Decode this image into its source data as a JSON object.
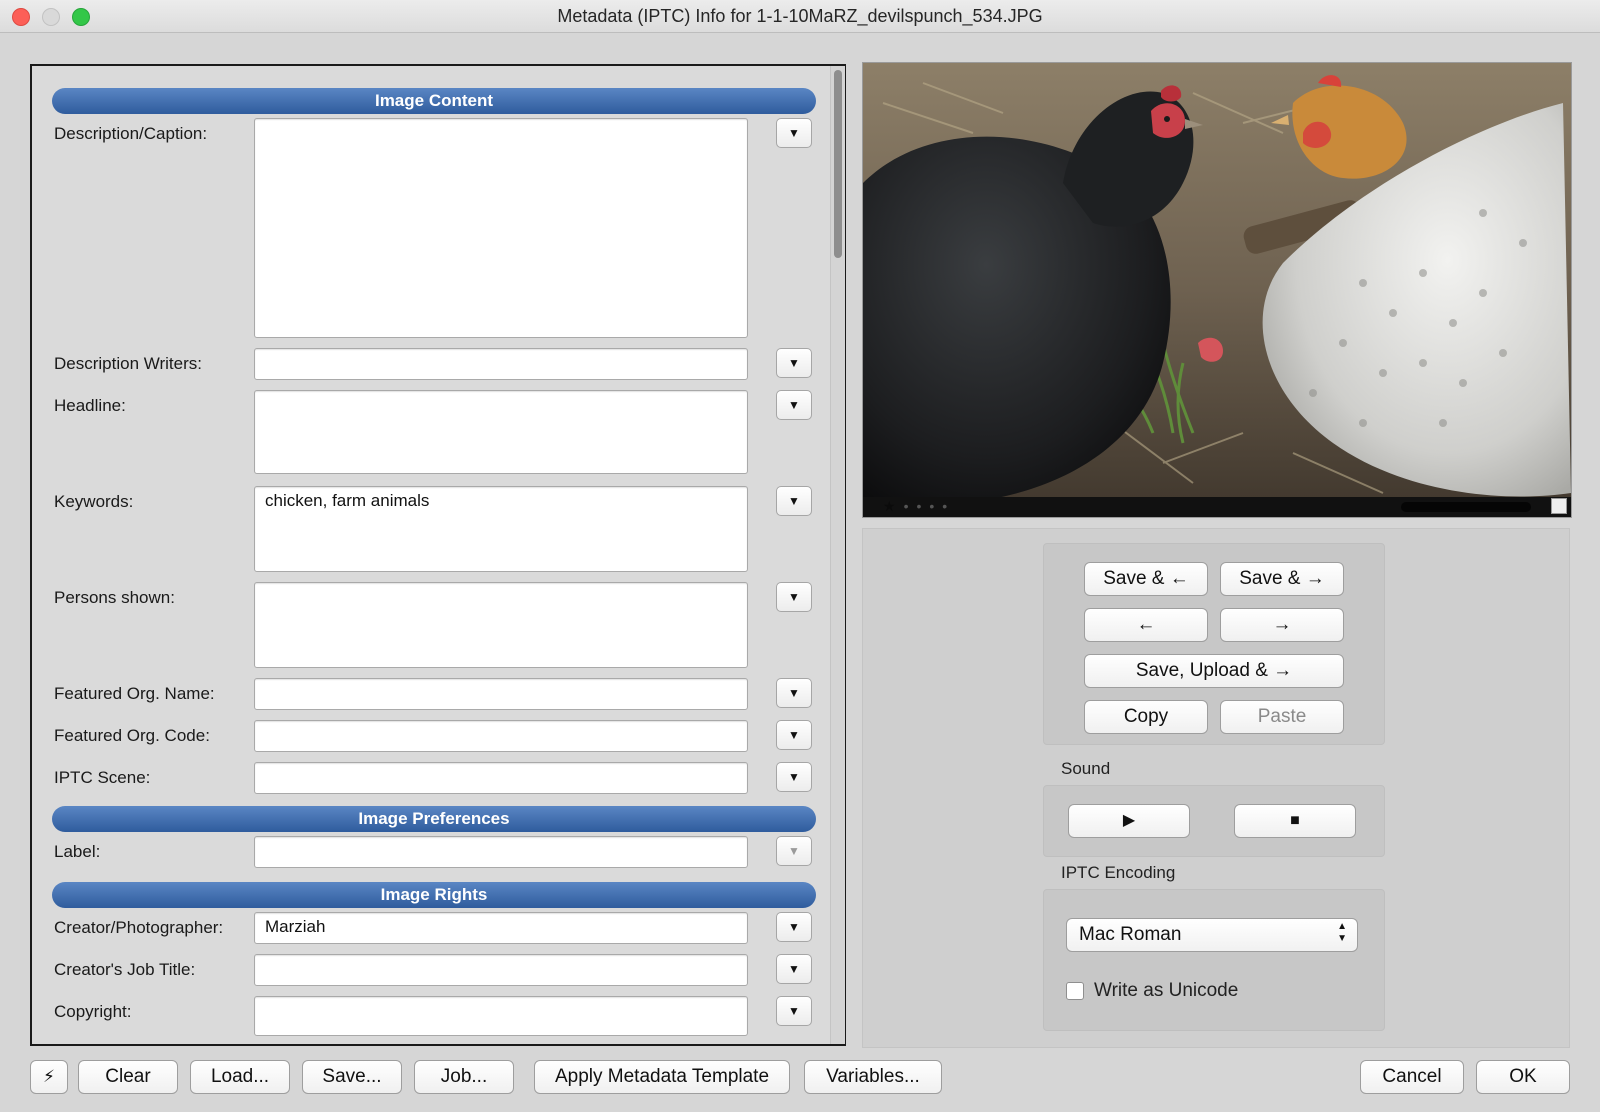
{
  "window": {
    "title": "Metadata (IPTC) Info for 1-1-10MaRZ_devilspunch_534.JPG"
  },
  "sections": {
    "content": "Image Content",
    "preferences": "Image Preferences",
    "rights": "Image Rights"
  },
  "fields": {
    "description_caption": {
      "label": "Description/Caption:",
      "value": ""
    },
    "description_writers": {
      "label": "Description Writers:",
      "value": ""
    },
    "headline": {
      "label": "Headline:",
      "value": ""
    },
    "keywords": {
      "label": "Keywords:",
      "value": "chicken, farm animals"
    },
    "persons_shown": {
      "label": "Persons shown:",
      "value": ""
    },
    "featured_org_name": {
      "label": "Featured Org. Name:",
      "value": ""
    },
    "featured_org_code": {
      "label": "Featured Org. Code:",
      "value": ""
    },
    "iptc_scene": {
      "label": "IPTC Scene:",
      "value": ""
    },
    "label": {
      "label": "Label:",
      "value": ""
    },
    "creator": {
      "label": "Creator/Photographer:",
      "value": "Marziah"
    },
    "creator_job_title": {
      "label": "Creator's Job Title:",
      "value": ""
    },
    "copyright": {
      "label": "Copyright:",
      "value": ""
    }
  },
  "icons": {
    "dropdown": "▼",
    "play": "▶",
    "stop": "■",
    "lightning": "⚡",
    "select_arrows": "▲▼"
  },
  "nav": {
    "save_prev": "Save & ←",
    "save_next": "Save & →",
    "prev": "←",
    "next": "→",
    "save_upload_next": "Save, Upload & →",
    "copy": "Copy",
    "paste": "Paste"
  },
  "sound": {
    "label": "Sound"
  },
  "encoding": {
    "label": "IPTC Encoding",
    "selected": "Mac Roman",
    "write_unicode_label": "Write as Unicode",
    "write_unicode_checked": false
  },
  "preview": {
    "rating_stars": 1,
    "rating_max": 5
  },
  "toolbar": {
    "clear": "Clear",
    "load": "Load...",
    "save": "Save...",
    "job": "Job...",
    "apply_template": "Apply Metadata Template",
    "variables": "Variables...",
    "cancel": "Cancel",
    "ok": "OK"
  },
  "colors": {
    "section_header": "#3f6db0",
    "window_bg": "#d6d6d6"
  }
}
